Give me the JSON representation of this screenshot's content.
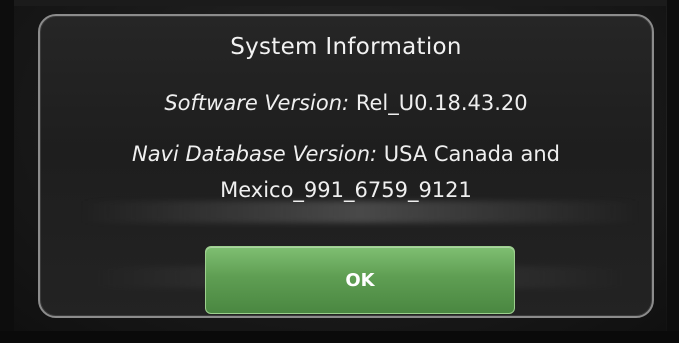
{
  "dialog": {
    "title": "System Information",
    "software_label": "Software Version:",
    "software_value": "Rel_U0.18.43.20",
    "navi_label": "Navi Database Version:",
    "navi_value_line1": "USA Canada and",
    "navi_value_line2": "Mexico_991_6759_9121",
    "ok_label": "OK"
  },
  "colors": {
    "text": "#f2f2f2",
    "button_green": "#5f9e53",
    "dialog_border": "#8c8c8c"
  }
}
